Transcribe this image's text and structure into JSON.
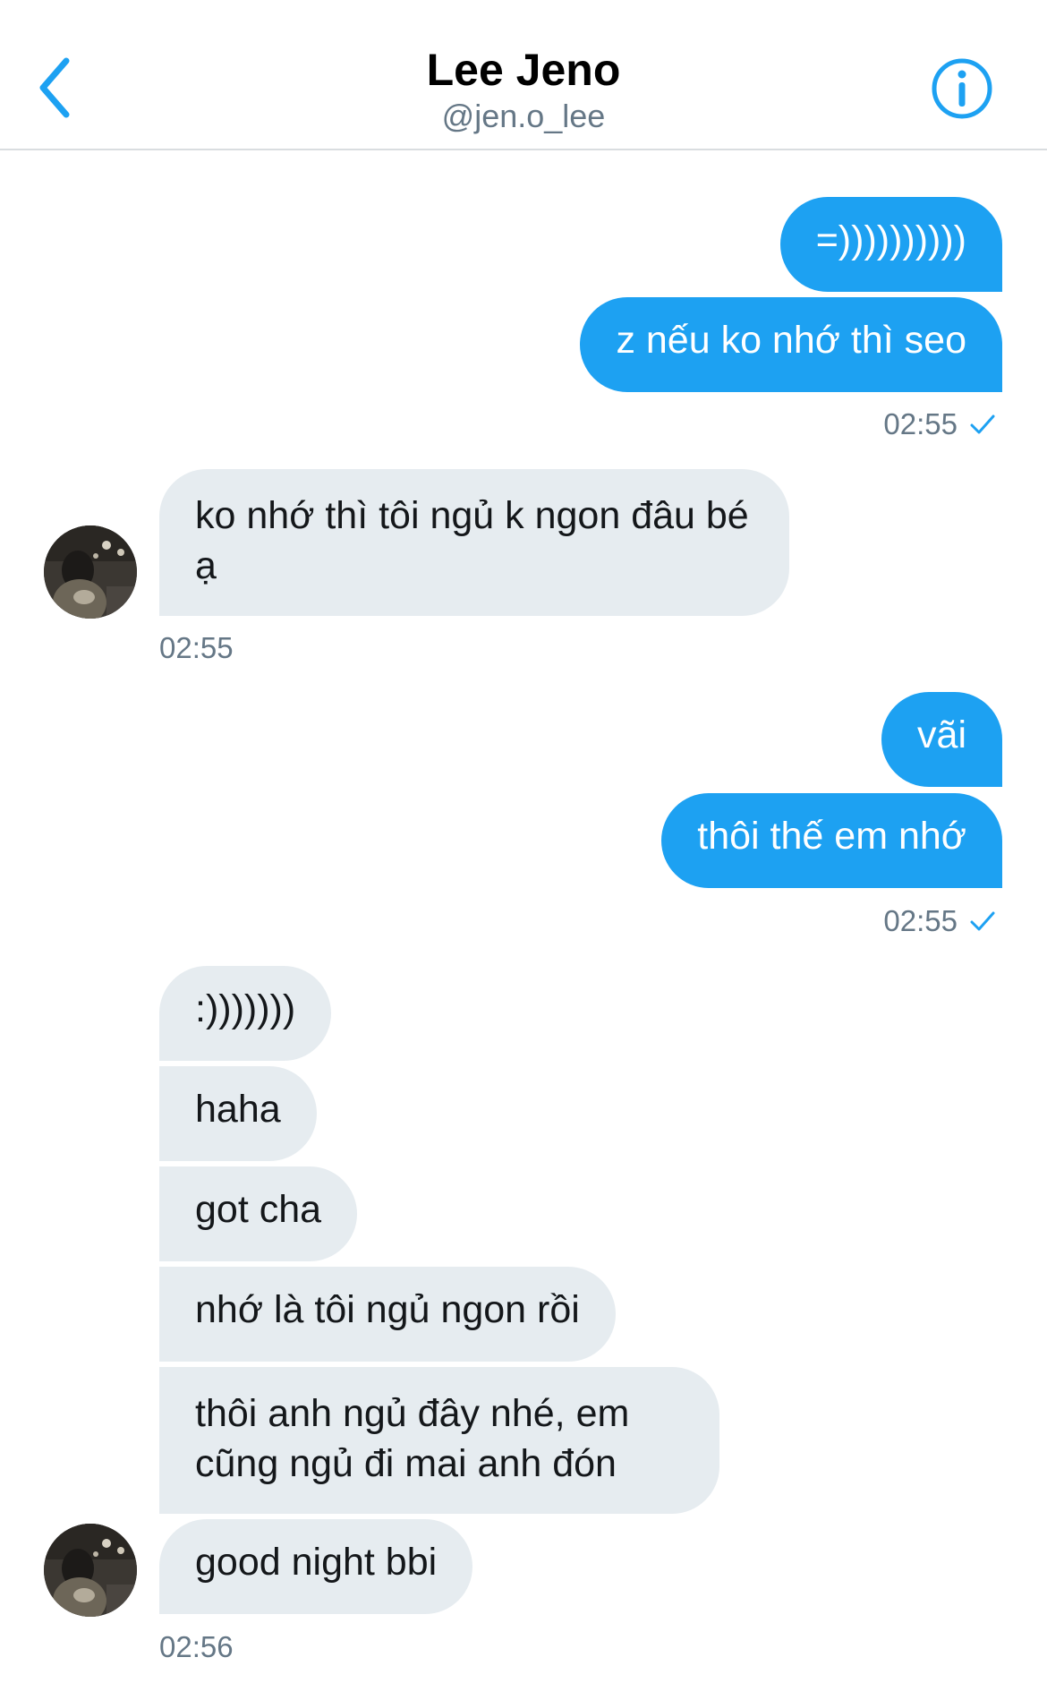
{
  "header": {
    "title": "Lee Jeno",
    "handle": "@jen.o_lee"
  },
  "colors": {
    "accent": "#1da1f2",
    "incoming_bubble": "#e6ecf0",
    "secondary_text": "#657786"
  },
  "messages": [
    {
      "side": "out",
      "text": "=))))))))))"
    },
    {
      "side": "out",
      "text": "z nếu ko nhớ thì seo"
    },
    {
      "side": "out_time",
      "text": "02:55"
    },
    {
      "side": "in",
      "text": "ko nhớ thì tôi ngủ k ngon đâu bé ạ"
    },
    {
      "side": "in_time",
      "text": "02:55"
    },
    {
      "side": "out",
      "text": "vãi"
    },
    {
      "side": "out",
      "text": "thôi thế em nhớ"
    },
    {
      "side": "out_time",
      "text": "02:55"
    },
    {
      "side": "in",
      "text": ":)))))))"
    },
    {
      "side": "in",
      "text": "haha"
    },
    {
      "side": "in",
      "text": "got cha"
    },
    {
      "side": "in",
      "text": "nhớ là tôi ngủ ngon rồi"
    },
    {
      "side": "in",
      "text": "thôi anh ngủ đây nhé, em cũng ngủ đi mai anh đón"
    },
    {
      "side": "in",
      "text": "good night bbi"
    },
    {
      "side": "in_time",
      "text": "02:56"
    }
  ]
}
